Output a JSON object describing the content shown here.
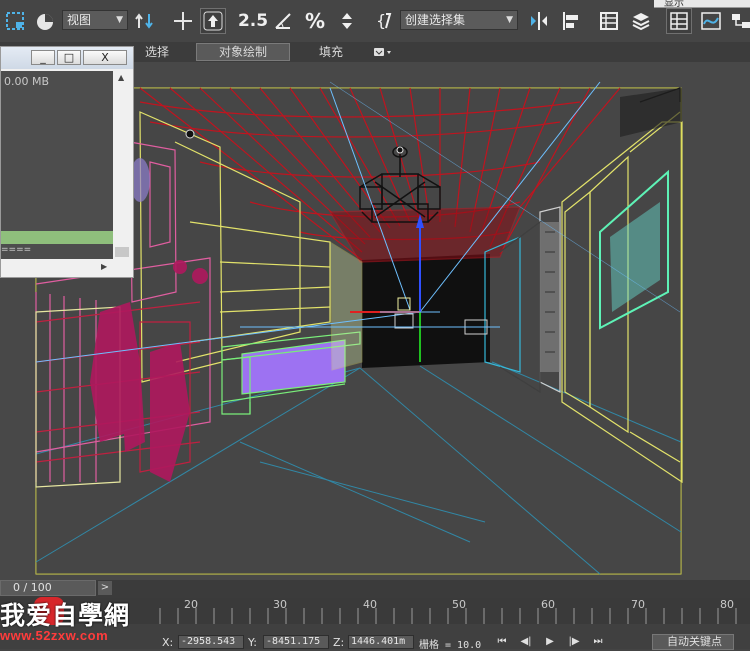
{
  "toolbar": {
    "view_dropdown": "视图",
    "snap_label": "2.5",
    "percent_snap": "%",
    "selection_set": "创建选择集",
    "top_field": "显示"
  },
  "ribbon": {
    "tabs": [
      {
        "label": "选择",
        "active": false
      },
      {
        "label": "对象绘制",
        "active": true
      },
      {
        "label": "填充",
        "active": false
      }
    ]
  },
  "float_window": {
    "memory": "0.00 MB",
    "dashes": "====",
    "buttons": {
      "minimize": "_",
      "maximize": "□",
      "close": "X"
    }
  },
  "viewport": {
    "background": "#484848",
    "safe_frame_color": "#d8d84a"
  },
  "timeline": {
    "frame": "0 / 100",
    "next": ">",
    "ticks": [
      "20",
      "30",
      "40",
      "50",
      "60",
      "70",
      "80"
    ]
  },
  "status": {
    "x_label": "X:",
    "x_value": "-2958.543",
    "y_label": "Y:",
    "y_value": "-8451.175",
    "z_label": "Z:",
    "z_value": "1446.401m",
    "grid_label": "栅格 = 10.0",
    "auto_key": "自动关键点",
    "playback": [
      "⏮",
      "◀|",
      "▶",
      "|▶",
      "⏭"
    ]
  },
  "watermark": {
    "title": "我爱自學網",
    "url": "www.52zxw.com"
  }
}
